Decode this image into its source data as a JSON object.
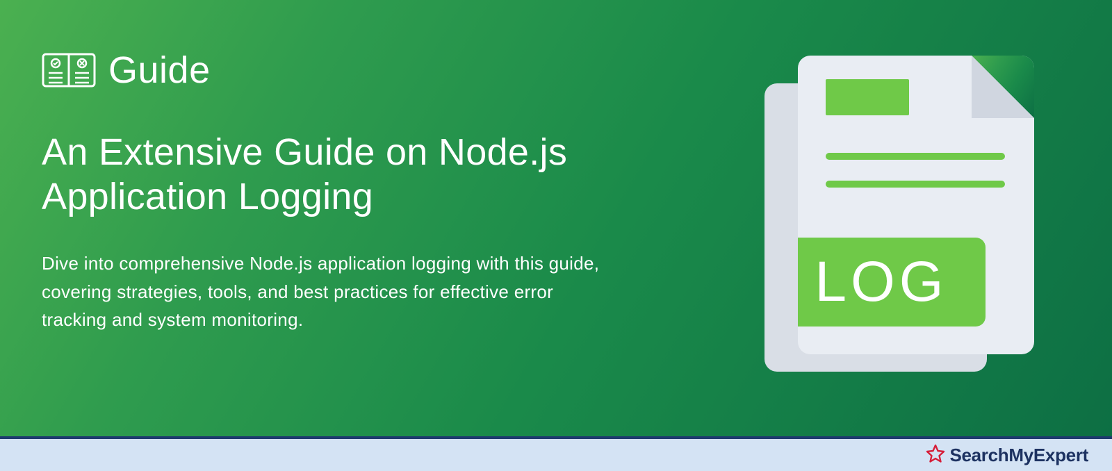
{
  "header": {
    "guide_label": "Guide"
  },
  "content": {
    "title": "An Extensive Guide on Node.js Application Logging",
    "subtitle": "Dive into comprehensive Node.js application logging with this guide, covering strategies, tools, and best practices for effective error tracking and system monitoring."
  },
  "illustration": {
    "log_badge_text": "LOG"
  },
  "footer": {
    "brand_name": "SearchMyExpert"
  },
  "colors": {
    "accent_green": "#6fc948",
    "footer_bg": "#d4e3f4",
    "footer_border": "#1e3a6e",
    "brand_text": "#1d3261"
  }
}
